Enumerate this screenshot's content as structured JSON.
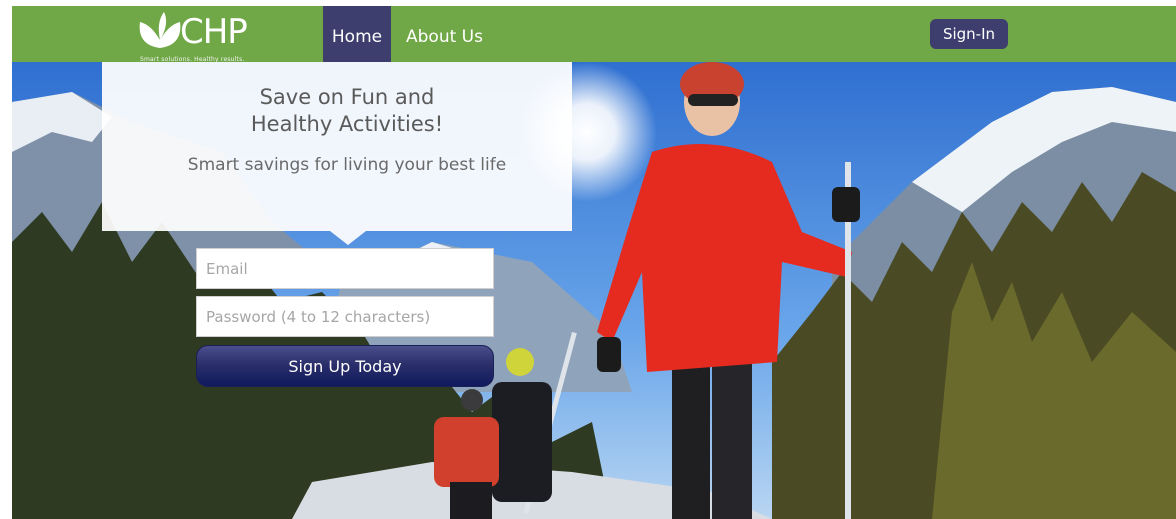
{
  "brand": {
    "name": "CHP",
    "tagline": "Smart solutions. Healthy results.",
    "logo_icon": "leaf-icon",
    "header_color": "#71a847",
    "accent_color": "#3d3e6e"
  },
  "nav": {
    "home": "Home",
    "about": "About Us",
    "signin": "Sign-In"
  },
  "hero": {
    "headline_line1": "Save on Fun and",
    "headline_line2": "Healthy Activities!",
    "subheadline": "Smart savings for living your best life"
  },
  "form": {
    "email_placeholder": "Email",
    "password_placeholder": "Password (4 to 12 characters)",
    "submit_label": "Sign Up Today"
  }
}
